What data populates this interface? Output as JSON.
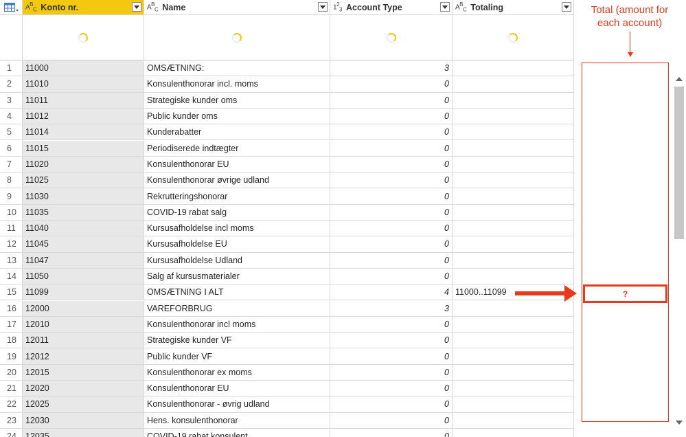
{
  "columns": [
    {
      "type_icon": "ABC",
      "label": "Konto nr.",
      "selected": true
    },
    {
      "type_icon": "ABC",
      "label": "Name",
      "selected": false
    },
    {
      "type_icon": "123",
      "label": "Account Type",
      "selected": false
    },
    {
      "type_icon": "ABC",
      "label": "Totaling",
      "selected": false
    }
  ],
  "rows": [
    {
      "n": "1",
      "konto": "11000",
      "name": "OMSÆTNING:",
      "type": "3",
      "totaling": ""
    },
    {
      "n": "2",
      "konto": "11010",
      "name": "Konsulenthonorar incl. moms",
      "type": "0",
      "totaling": ""
    },
    {
      "n": "3",
      "konto": "11011",
      "name": "Strategiske kunder oms",
      "type": "0",
      "totaling": ""
    },
    {
      "n": "4",
      "konto": "11012",
      "name": "Public kunder oms",
      "type": "0",
      "totaling": ""
    },
    {
      "n": "5",
      "konto": "11014",
      "name": "Kunderabatter",
      "type": "0",
      "totaling": ""
    },
    {
      "n": "6",
      "konto": "11015",
      "name": "Periodiserede indtægter",
      "type": "0",
      "totaling": ""
    },
    {
      "n": "7",
      "konto": "11020",
      "name": "Konsulenthonorar EU",
      "type": "0",
      "totaling": ""
    },
    {
      "n": "8",
      "konto": "11025",
      "name": "Konsulenthonorar øvrige udland",
      "type": "0",
      "totaling": ""
    },
    {
      "n": "9",
      "konto": "11030",
      "name": "Rekrutteringshonorar",
      "type": "0",
      "totaling": ""
    },
    {
      "n": "10",
      "konto": "11035",
      "name": "COVID-19 rabat salg",
      "type": "0",
      "totaling": ""
    },
    {
      "n": "11",
      "konto": "11040",
      "name": "Kursusafholdelse incl moms",
      "type": "0",
      "totaling": ""
    },
    {
      "n": "12",
      "konto": "11045",
      "name": "Kursusafholdelse EU",
      "type": "0",
      "totaling": ""
    },
    {
      "n": "13",
      "konto": "11047",
      "name": "Kursusafholdelse Udland",
      "type": "0",
      "totaling": ""
    },
    {
      "n": "14",
      "konto": "11050",
      "name": "Salg af kursusmaterialer",
      "type": "0",
      "totaling": ""
    },
    {
      "n": "15",
      "konto": "11099",
      "name": "OMSÆTNING I ALT",
      "type": "4",
      "totaling": "11000..11099"
    },
    {
      "n": "16",
      "konto": "12000",
      "name": "VAREFORBRUG",
      "type": "3",
      "totaling": ""
    },
    {
      "n": "17",
      "konto": "12010",
      "name": "Konsulenthonorar incl moms",
      "type": "0",
      "totaling": ""
    },
    {
      "n": "18",
      "konto": "12011",
      "name": "Strategiske kunder VF",
      "type": "0",
      "totaling": ""
    },
    {
      "n": "19",
      "konto": "12012",
      "name": "Public kunder VF",
      "type": "0",
      "totaling": ""
    },
    {
      "n": "20",
      "konto": "12015",
      "name": "Konsulenthonorar ex moms",
      "type": "0",
      "totaling": ""
    },
    {
      "n": "21",
      "konto": "12020",
      "name": "Konsulenthonorar EU",
      "type": "0",
      "totaling": ""
    },
    {
      "n": "22",
      "konto": "12025",
      "name": "Konsulenthonorar - øvrig udland",
      "type": "0",
      "totaling": ""
    },
    {
      "n": "23",
      "konto": "12030",
      "name": "Hens. konsulenthonorar",
      "type": "0",
      "totaling": ""
    },
    {
      "n": "24",
      "konto": "12035",
      "name": "COVID-19 rabat konsulent",
      "type": "0",
      "totaling": ""
    }
  ],
  "annotation": {
    "note": "Total (amount for each account)",
    "placeholder": "?"
  },
  "colors": {
    "accent": "#f2c811",
    "annotation": "#e8391e"
  }
}
